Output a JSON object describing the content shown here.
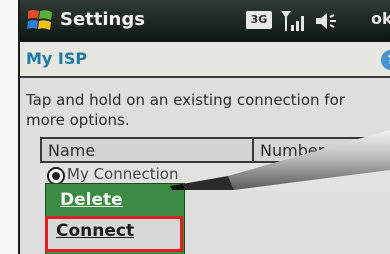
{
  "titlebar": {
    "title": "Settings",
    "network_badge": "3G",
    "ok_label": "ok"
  },
  "page": {
    "title": "My ISP",
    "help": "?",
    "instructions": "Tap and hold on an existing connection for more options."
  },
  "table": {
    "columns": [
      "Name",
      "Number"
    ],
    "rows": [
      {
        "name": "My Connection",
        "selected": true
      }
    ]
  },
  "context_menu": {
    "items": [
      {
        "label": "Delete"
      },
      {
        "label": "Connect",
        "highlighted": true
      }
    ]
  },
  "colors": {
    "title_bar": "#1a241e",
    "heading_text": "#1f7aa6",
    "menu_bg": "#3b8b43",
    "highlight_border": "#e02020"
  }
}
